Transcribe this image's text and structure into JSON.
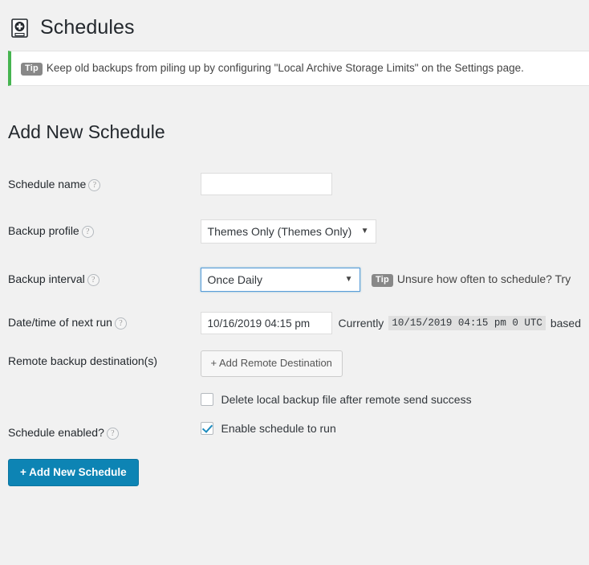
{
  "header": {
    "title": "Schedules",
    "icon": "backup-disk-plus-icon"
  },
  "notice": {
    "badge": "Tip",
    "text": "Keep old backups from piling up by configuring \"Local Archive Storage Limits\" on the Settings page.",
    "accent_color": "#46b450"
  },
  "form": {
    "section_title": "Add New Schedule",
    "help_glyph": "?",
    "rows": {
      "schedule_name": {
        "label": "Schedule name",
        "value": "",
        "placeholder": ""
      },
      "backup_profile": {
        "label": "Backup profile",
        "selected": "Themes Only (Themes Only)",
        "caret": "▼"
      },
      "backup_interval": {
        "label": "Backup interval",
        "selected": "Once Daily",
        "caret": "▼",
        "tip_badge": "Tip",
        "tip_text": "Unsure how often to schedule? Try"
      },
      "next_run": {
        "label": "Date/time of next run",
        "value": "10/16/2019 04:15 pm",
        "currently_label": "Currently",
        "currently_value": "10/15/2019 04:15 pm 0 UTC",
        "based_text": "based"
      },
      "remote_destinations": {
        "label": "Remote backup destination(s)",
        "add_button": "+ Add Remote Destination",
        "delete_local_label": "Delete local backup file after remote send success",
        "delete_local_checked": false
      },
      "schedule_enabled": {
        "label": "Schedule enabled?",
        "checkbox_label": "Enable schedule to run",
        "checked": true
      }
    },
    "submit_label": "+ Add New Schedule",
    "submit_color": "#0d84b4"
  }
}
